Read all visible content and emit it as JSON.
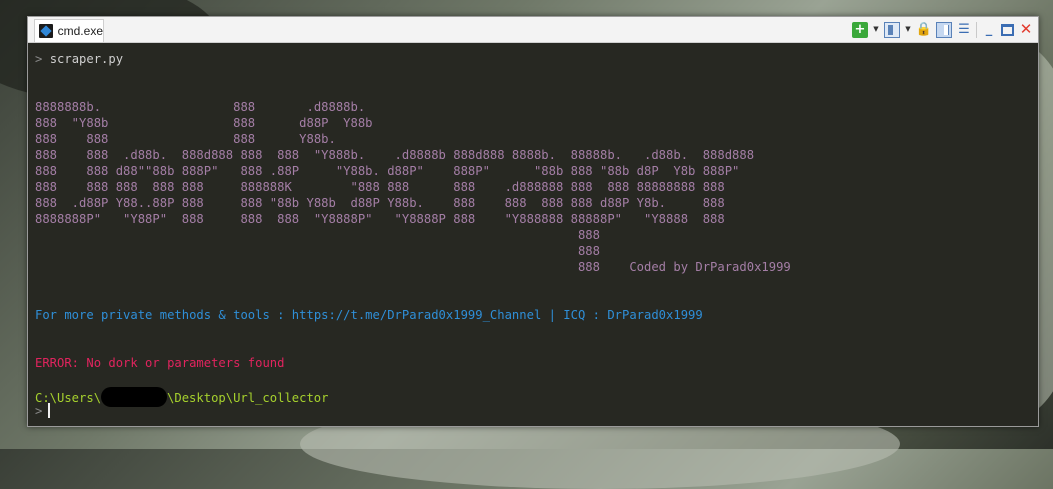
{
  "window": {
    "tab_title": "cmd.exe",
    "toolbar_icons": [
      "add-console-icon",
      "dropdown-arrow-icon",
      "panel-icon",
      "dropdown-arrow-icon",
      "lock-icon",
      "split-view-icon",
      "menu-icon",
      "minimize-icon",
      "maximize-icon",
      "close-icon"
    ]
  },
  "console": {
    "command_prompt": ">",
    "command": "scraper.py",
    "ascii_art": [
      "8888888b.                  888       .d8888b.",
      "888  \"Y88b                 888      d88P  Y88b",
      "888    888                 888      Y88b.",
      "888    888  .d88b.  888d888 888  888  \"Y888b.    .d8888b 888d888 8888b.  88888b.   .d88b.  888d888",
      "888    888 d88\"\"88b 888P\"   888 .88P     \"Y88b. d88P\"    888P\"      \"88b 888 \"88b d8P  Y8b 888P\"",
      "888    888 888  888 888     888888K        \"888 888      888    .d888888 888  888 88888888 888",
      "888  .d88P Y88..88P 888     888 \"88b Y88b  d88P Y88b.    888    888  888 888 d88P Y8b.     888",
      "8888888P\"   \"Y88P\"  888     888  888  \"Y8888P\"   \"Y8888P 888    \"Y888888 88888P\"   \"Y8888  888",
      "                                                                          888",
      "                                                                          888",
      "                                                                          888    Coded by DrParad0x1999"
    ],
    "info_line": "For more private methods & tools : https://t.me/DrParad0x1999_Channel | ICQ : DrParad0x1999",
    "error_line": "ERROR: No dork or parameters found",
    "path_prefix": "C:\\Users\\",
    "path_suffix": "\\Desktop\\Url_collector",
    "input_prompt": ">"
  },
  "colors": {
    "background": "#272822",
    "ascii": "#a47ea6",
    "info": "#2f8fd8",
    "error": "#e0245e",
    "path": "#a6d12d"
  }
}
